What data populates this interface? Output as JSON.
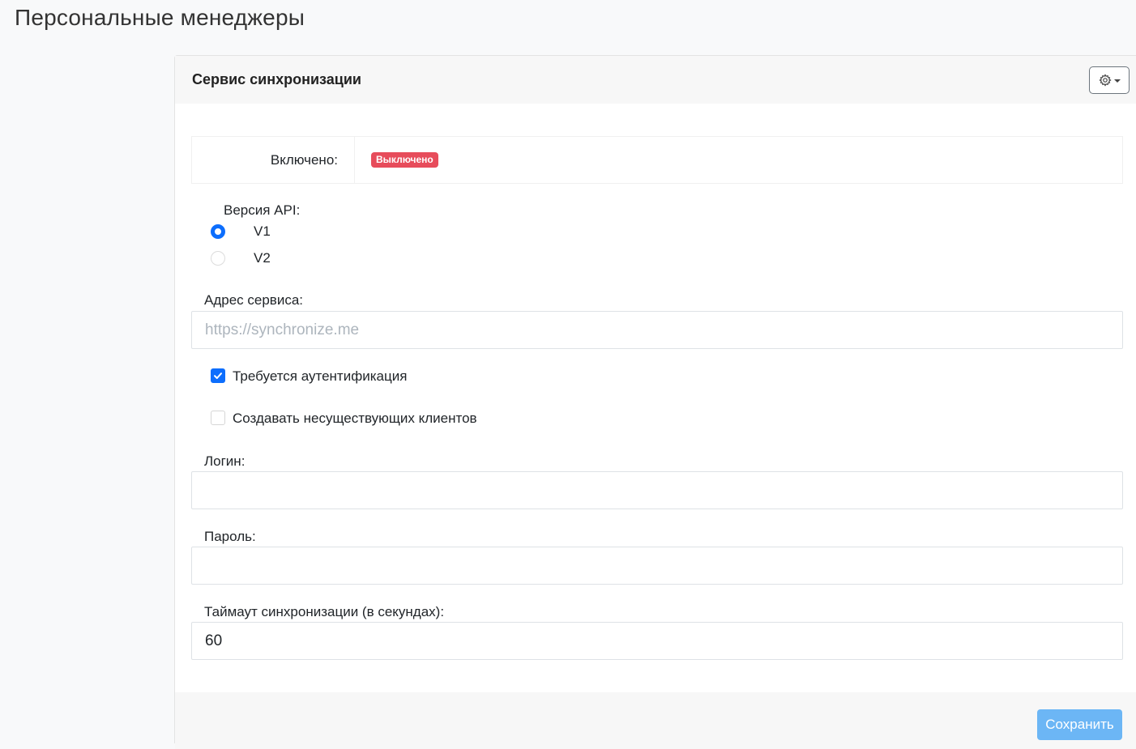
{
  "page": {
    "title": "Персональные менеджеры"
  },
  "card": {
    "title": "Сервис синхронизации",
    "settings_icon": "gear-icon"
  },
  "status": {
    "label": "Включено:",
    "value": "Выключено",
    "badge_color": "#e74c5b"
  },
  "api_version": {
    "label": "Версия API:",
    "options": [
      {
        "label": "V1",
        "checked": true
      },
      {
        "label": "V2",
        "checked": false
      }
    ]
  },
  "service_address": {
    "label": "Адрес сервиса:",
    "value": "",
    "placeholder": "https://synchronize.me"
  },
  "auth_required": {
    "label": "Требуется аутентификация",
    "checked": true
  },
  "create_missing_clients": {
    "label": "Создавать несуществующих клиентов",
    "checked": false
  },
  "login": {
    "label": "Логин:",
    "value": ""
  },
  "password": {
    "label": "Пароль:",
    "value": ""
  },
  "timeout": {
    "label": "Таймаут синхронизации (в секундах):",
    "value": "60"
  },
  "footer": {
    "save_label": "Сохранить"
  },
  "colors": {
    "accent": "#0d6efd",
    "save_button": "#6cb6f5",
    "danger": "#e74c5b"
  }
}
